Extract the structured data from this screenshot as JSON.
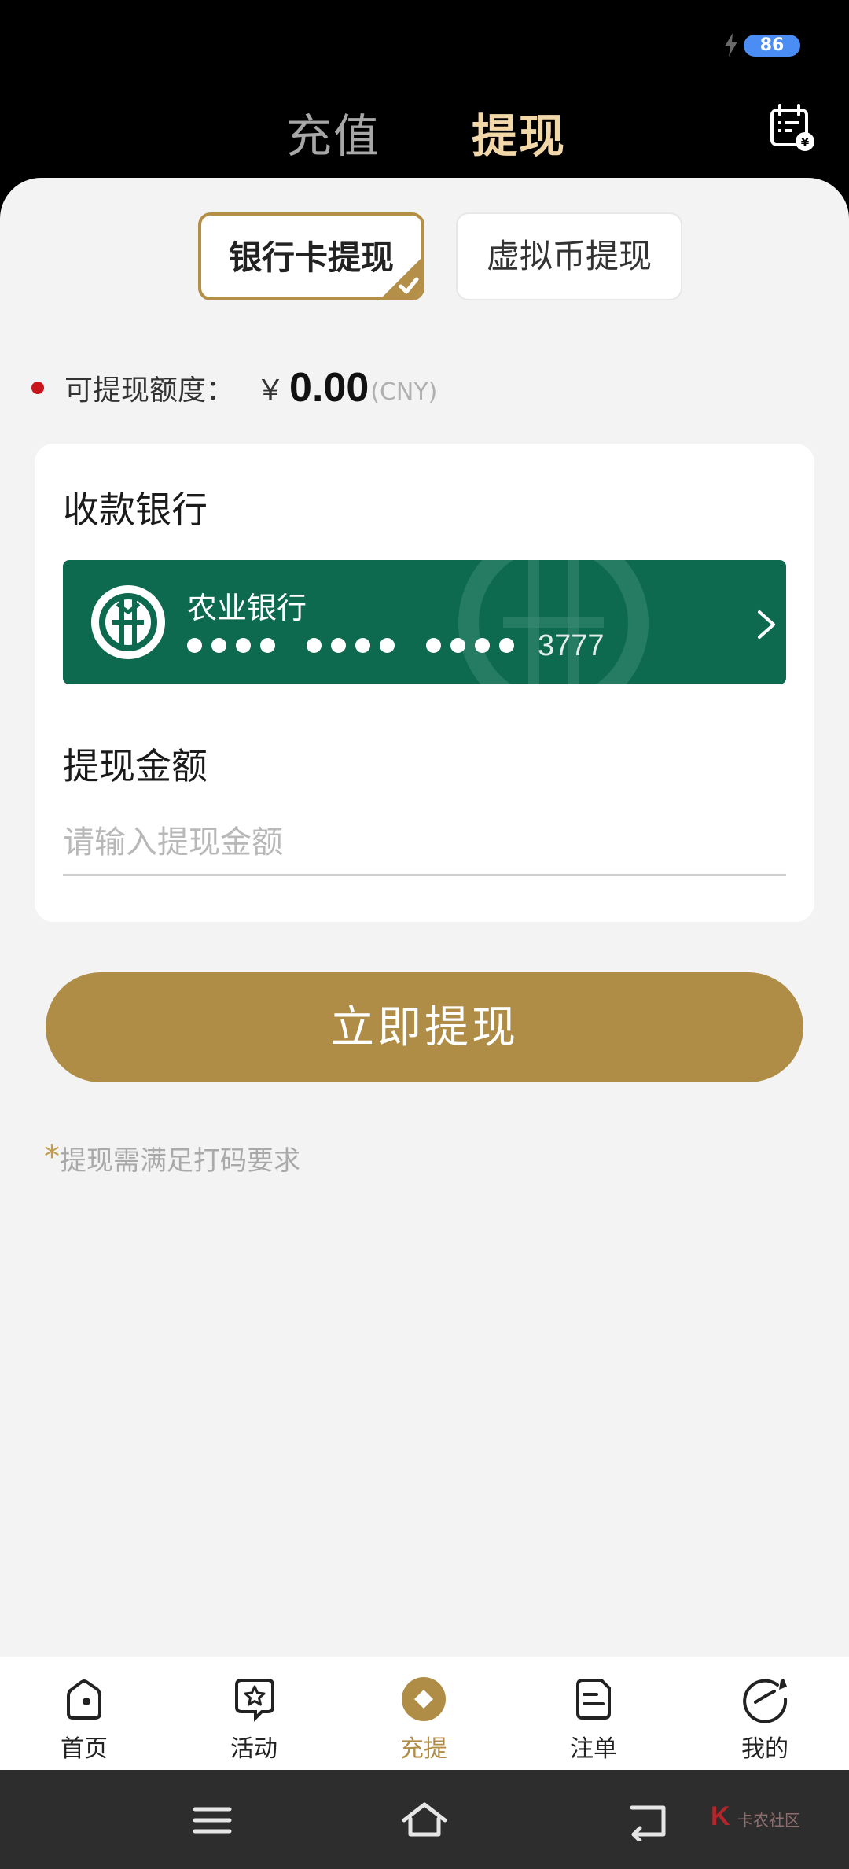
{
  "status_bar": {
    "battery": "86"
  },
  "header": {
    "tabs": [
      {
        "label": "充值",
        "active": false
      },
      {
        "label": "提现",
        "active": true
      }
    ]
  },
  "withdraw_type": {
    "options": [
      {
        "label": "银行卡提现",
        "selected": true
      },
      {
        "label": "虚拟币提现",
        "selected": false
      }
    ]
  },
  "quota": {
    "label": "可提现额度：",
    "currency_symbol": "￥",
    "amount": "0.00",
    "unit": "(CNY)"
  },
  "form": {
    "bank_title": "收款银行",
    "bank_card": {
      "name": "农业银行",
      "last4": "3777",
      "color": "#0d6a4e"
    },
    "amount_title": "提现金额",
    "amount_placeholder": "请输入提现金额",
    "amount_value": ""
  },
  "submit_label": "立即提现",
  "note": {
    "star": "*",
    "text": "提现需满足打码要求"
  },
  "tabbar": {
    "items": [
      {
        "label": "首页",
        "icon": "home-icon",
        "active": false
      },
      {
        "label": "活动",
        "icon": "star-badge-icon",
        "active": false
      },
      {
        "label": "充提",
        "icon": "coin-icon",
        "active": true
      },
      {
        "label": "注单",
        "icon": "document-icon",
        "active": false
      },
      {
        "label": "我的",
        "icon": "profile-icon",
        "active": false
      }
    ]
  },
  "watermark": {
    "k": "K",
    "text": "卡农社区"
  },
  "colors": {
    "accent": "#b08d47",
    "header_active": "#f2d7a8",
    "bank_green": "#0d6a4e"
  }
}
